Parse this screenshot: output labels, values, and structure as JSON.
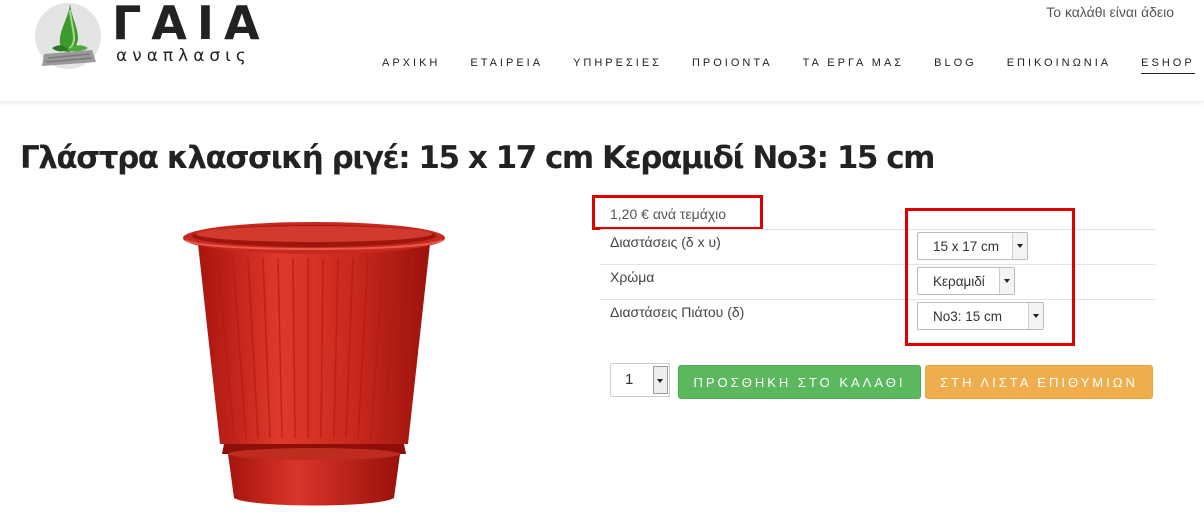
{
  "brand": {
    "name": "ΓΑΙΑ",
    "tagline": "αναπλασις"
  },
  "header": {
    "cart_status": "Το καλάθι είναι άδειο"
  },
  "nav": {
    "items": [
      "ΑΡΧΙΚΗ",
      "ΕΤΑΙΡΕΙΑ",
      "ΥΠΗΡΕΣΙΕΣ",
      "ΠΡΟΙΟΝΤΑ",
      "ΤΑ ΕΡΓΑ ΜΑΣ",
      "BLOG",
      "ΕΠΙΚΟΙΝΩΝΙΑ"
    ],
    "active": "ESHOP"
  },
  "product": {
    "title": "Γλάστρα κλασσική ριγέ: 15 x 17 cm Κεραμιδί Νο3: 15 cm",
    "price": "1,20 € ανά τεμάχιο",
    "options": [
      {
        "label": "Διαστάσεις (δ x υ)",
        "value": "15 x 17 cm"
      },
      {
        "label": "Χρώμα",
        "value": "Κεραμιδί"
      },
      {
        "label": "Διαστάσεις Πιάτου (δ)",
        "value": "Νο3: 15 cm"
      }
    ],
    "quantity": "1",
    "add_to_cart": "ΠΡΟΣΘΗΚΗ ΣΤΟ ΚΑΛΑΘΙ",
    "add_to_wishlist": "ΣΤΗ ΛΙΣΤΑ ΕΠΙΘΥΜΙΩΝ"
  },
  "colors": {
    "cart_button": "#5cb85c",
    "wishlist_button": "#f0ad4e",
    "highlight": "#e00000",
    "pot": "#c8281e"
  },
  "icons": [
    "dropdown-arrow-icon",
    "leaf-drop-logo-icon"
  ]
}
